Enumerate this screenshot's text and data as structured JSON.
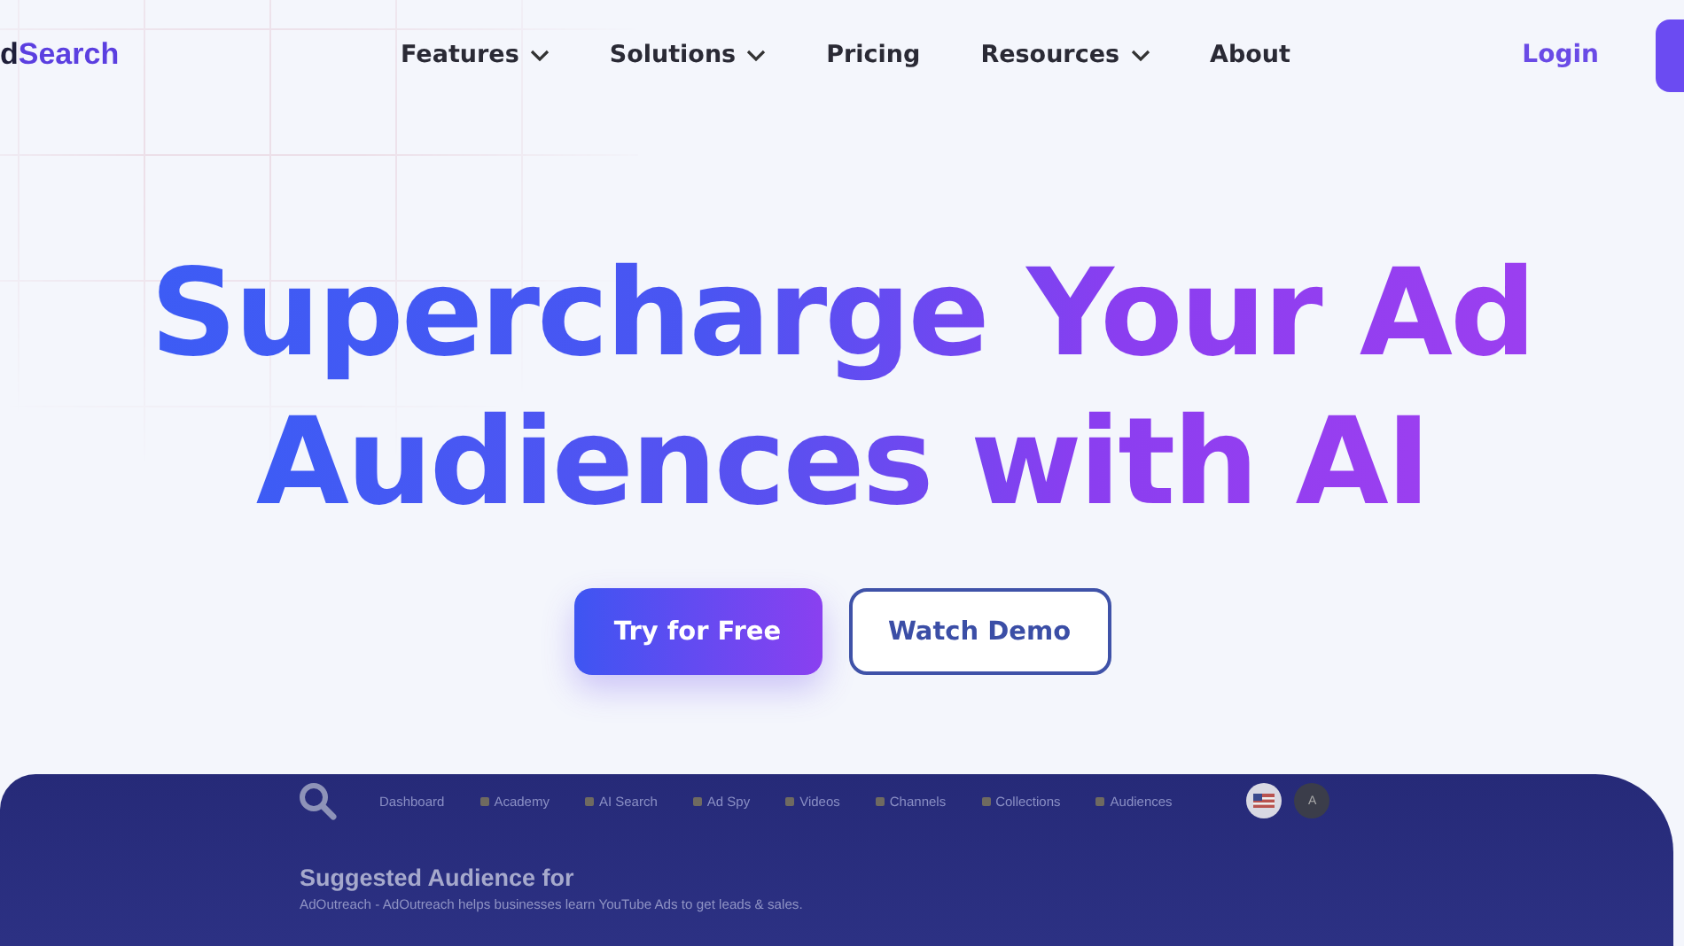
{
  "logo": {
    "lead": "d",
    "accent": "Search"
  },
  "nav": [
    {
      "label": "Features",
      "kind": "dropdown"
    },
    {
      "label": "Solutions",
      "kind": "dropdown"
    },
    {
      "label": "Pricing",
      "kind": "link"
    },
    {
      "label": "Resources",
      "kind": "dropdown"
    },
    {
      "label": "About",
      "kind": "link"
    }
  ],
  "login": "Login",
  "headline": [
    "Supercharge Your Ad",
    "Audiences with AI"
  ],
  "buttons": [
    {
      "label": "Try for Free",
      "kind": "primary"
    },
    {
      "label": "Watch Demo",
      "kind": "outline"
    }
  ],
  "app": {
    "nav": [
      "Dashboard",
      "Academy",
      "AI Search",
      "Ad Spy",
      "Videos",
      "Channels",
      "Collections",
      "Audiences"
    ],
    "avatar": "A",
    "title": "Suggested Audience for",
    "subtitle": "AdOutreach - AdOutreach helps businesses learn YouTube Ads to get leads & sales."
  }
}
